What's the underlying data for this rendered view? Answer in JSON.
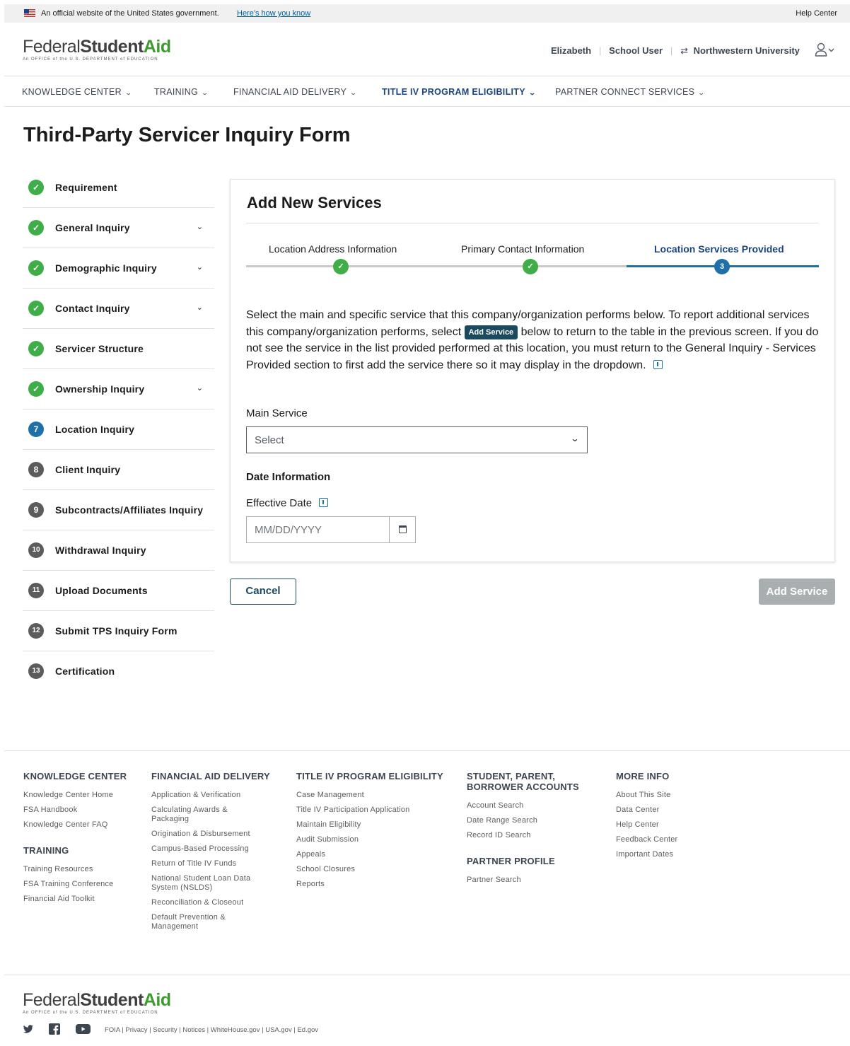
{
  "gov_banner": {
    "text": "An official website of the United States government.",
    "link": "Here's how you know",
    "help": "Help Center"
  },
  "logo": {
    "part1": "Federal",
    "part2": "Student",
    "part3": "Aid",
    "tagline": "An OFFICE of the U.S. DEPARTMENT of EDUCATION"
  },
  "user": {
    "name": "Elizabeth",
    "role": "School User",
    "school": "Northwestern University",
    "switch_icon": "swap-icon",
    "profile_icon": "user-icon"
  },
  "nav": {
    "items": [
      {
        "label": "KNOWLEDGE CENTER"
      },
      {
        "label": "TRAINING"
      },
      {
        "label": "FINANCIAL AID DELIVERY"
      },
      {
        "label": "TITLE IV PROGRAM ELIGIBILITY"
      },
      {
        "label": "PARTNER CONNECT SERVICES"
      }
    ],
    "active_index": 3
  },
  "page_title": "Third-Party Servicer Inquiry Form",
  "steps": [
    {
      "label": "Requirement",
      "status": "done"
    },
    {
      "label": "General Inquiry",
      "status": "done",
      "expand": true
    },
    {
      "label": "Demographic Inquiry",
      "status": "done",
      "expand": true
    },
    {
      "label": "Contact Inquiry",
      "status": "done",
      "expand": true
    },
    {
      "label": "Servicer Structure",
      "status": "done"
    },
    {
      "label": "Ownership Inquiry",
      "status": "done",
      "expand": true
    },
    {
      "label": "Location Inquiry",
      "status": "current",
      "num": "7"
    },
    {
      "label": "Client Inquiry",
      "status": "todo",
      "num": "8"
    },
    {
      "label": "Subcontracts/Affiliates Inquiry",
      "status": "todo",
      "num": "9"
    },
    {
      "label": "Withdrawal Inquiry",
      "status": "todo",
      "num": "10"
    },
    {
      "label": "Upload Documents",
      "status": "todo",
      "num": "11"
    },
    {
      "label": "Submit TPS Inquiry Form",
      "status": "todo",
      "num": "12"
    },
    {
      "label": "Certification",
      "status": "todo",
      "num": "13"
    }
  ],
  "card": {
    "title": "Add New Services",
    "tabs": [
      {
        "label": "Location Address Information",
        "status": "done"
      },
      {
        "label": "Primary Contact Information",
        "status": "done"
      },
      {
        "label": "Location Services Provided",
        "status": "current",
        "num": "3"
      }
    ],
    "intro_before": "Select the main and specific service that this company/organization performs below.  To report additional services this company/organization performs, select",
    "intro_button": "Add Service",
    "intro_after": "below to return to the table in the previous screen.  If you do not see the service in the list provided performed at this location, you must return to the General Inquiry - Services Provided section to first add the service there so it may display in the dropdown.",
    "main_service_label": "Main Service",
    "main_service_value": "Select",
    "date_section_label": "Date Information",
    "effective_date_label": "Effective Date",
    "effective_date_placeholder": "MM/DD/YYYY"
  },
  "actions": {
    "cancel": "Cancel",
    "add_service": "Add Service"
  },
  "footer": {
    "knowledge_center": {
      "heading": "KNOWLEDGE CENTER",
      "links": [
        "Knowledge Center Home",
        "FSA Handbook",
        "Knowledge Center FAQ"
      ]
    },
    "training": {
      "heading": "TRAINING",
      "links": [
        "Training Resources",
        "FSA Training Conference",
        "Financial Aid Toolkit"
      ]
    },
    "financial_aid_delivery": {
      "heading": "FINANCIAL AID DELIVERY",
      "links": [
        "Application & Verification",
        "Calculating Awards & Packaging",
        "Origination & Disbursement",
        "Campus-Based Processing",
        "Return of Title IV Funds",
        "National Student Loan Data System (NSLDS)",
        "Reconciliation & Closeout",
        "Default Prevention & Management"
      ]
    },
    "title_iv": {
      "heading": "TITLE IV PROGRAM ELIGIBILITY",
      "links": [
        "Case Management",
        "Title IV Participation Application",
        "Maintain Eligibility",
        "Audit Submission",
        "Appeals",
        "School Closures",
        "Reports"
      ]
    },
    "accounts": {
      "heading": "STUDENT, PARENT, BORROWER ACCOUNTS",
      "links": [
        "Account Search",
        "Date Range Search",
        "Record ID Search"
      ]
    },
    "partner_profile": {
      "heading": "PARTNER PROFILE",
      "links": [
        "Partner Search"
      ]
    },
    "more_info": {
      "heading": "MORE INFO",
      "links": [
        "About This Site",
        "Data Center",
        "Help Center",
        "Feedback Center",
        "Important Dates"
      ]
    },
    "legal": "FOIA  |  Privacy  |  Security  |  Notices  |  WhiteHouse.gov  |  USA.gov  |  Ed.gov",
    "social": [
      "twitter-icon",
      "facebook-icon",
      "youtube-icon"
    ]
  }
}
